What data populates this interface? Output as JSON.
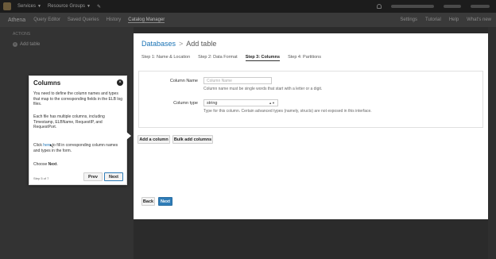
{
  "topbar": {
    "services": "Services",
    "resource_groups": "Resource Groups"
  },
  "athena_nav": {
    "brand": "Athena",
    "items": [
      "Query Editor",
      "Saved Queries",
      "History",
      "Catalog Manager"
    ],
    "right_items": [
      "Settings",
      "Tutorial",
      "Help",
      "What's new"
    ]
  },
  "sidebar": {
    "heading": "ACTIONS",
    "add_table": "Add table"
  },
  "breadcrumb": {
    "databases": "Databases",
    "separator": ">",
    "current": "Add table"
  },
  "steps": [
    "Step 1: Name & Location",
    "Step 2: Data Format",
    "Step 3: Columns",
    "Step 4: Partitions"
  ],
  "form": {
    "column_name_label": "Column Name",
    "column_name_placeholder": "Column Name",
    "column_name_help": "Column name must be single words that start with a letter or a digit.",
    "column_type_label": "Column type",
    "column_type_value": "string",
    "column_type_help": "Type for this column. Certain advanced types (namely, structs) are not exposed in this interface."
  },
  "buttons": {
    "add_column": "Add a column",
    "bulk_add": "Bulk add columns",
    "back": "Back",
    "next": "Next"
  },
  "tutorial": {
    "title": "Columns",
    "close": "×",
    "para1": "You need to define the column names and types that map to the corresponding fields in the ELB log files.",
    "para2": "Each file has multiple columns, including Timestamp, ELBName, RequestIP, and RequestPort.",
    "para3_prefix": "Click ",
    "para3_link": "here",
    "para3_suffix": " to fill in corresponding column names and types in the form.",
    "para4_prefix": "Choose ",
    "para4_bold": "Next",
    "para4_suffix": ".",
    "step_of": "Step 5 of 7",
    "prev": "Prev",
    "next": "Next"
  }
}
